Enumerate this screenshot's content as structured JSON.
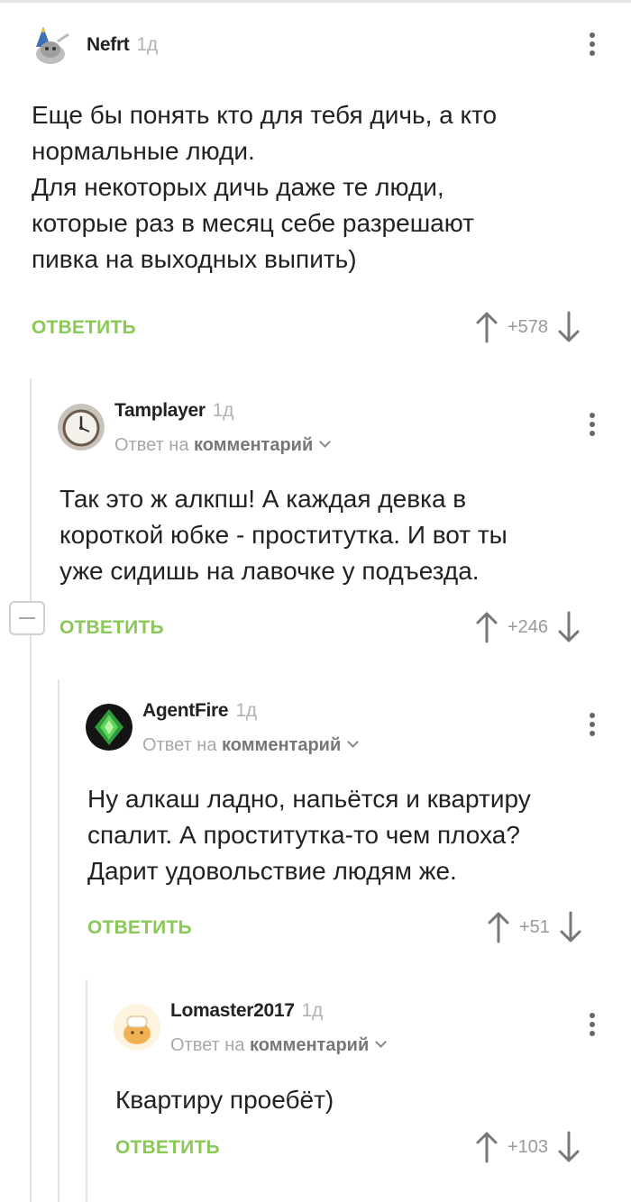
{
  "comments": [
    {
      "author": "Nefrt",
      "age": "1д",
      "reply_prefix": "",
      "reply_target": "",
      "text": "Еще бы понять кто для тебя дичь, а кто\nнормальные люди.\nДля некоторых дичь даже те люди,\nкоторые раз в месяц себе разрешают\nпивка на выходных выпить)",
      "reply_label": "ОТВЕТИТЬ",
      "score": "+578"
    },
    {
      "author": "Tamplayer",
      "age": "1д",
      "reply_prefix": "Ответ на",
      "reply_target": "комментарий",
      "text": "Так это ж алкпш! А каждая девка в\nкороткой юбке - проститутка. И вот ты\nуже сидишь на лавочке у подъезда.",
      "reply_label": "ОТВЕТИТЬ",
      "score": "+246"
    },
    {
      "author": "AgentFire",
      "age": "1д",
      "reply_prefix": "Ответ на",
      "reply_target": "комментарий",
      "text": "Ну алкаш ладно, напьётся и квартиру\nспалит. А проститутка-то чем плоха?\nДарит удовольствие людям же.",
      "reply_label": "ОТВЕТИТЬ",
      "score": "+51"
    },
    {
      "author": "Lomaster2017",
      "age": "1д",
      "reply_prefix": "Ответ на",
      "reply_target": "комментарий",
      "text": "Квартиру проебёт)",
      "reply_label": "ОТВЕТИТЬ",
      "score": "+103"
    }
  ],
  "colors": {
    "accent_green": "#8ac858",
    "muted_text": "#a8a8a8",
    "thread_line": "#e3e3e3"
  },
  "icons": {
    "more": "vertical-dots-icon",
    "upvote": "arrow-up-icon",
    "downvote": "arrow-down-icon",
    "collapse": "minus-box-icon",
    "reply_chevron": "chevron-down-icon"
  }
}
